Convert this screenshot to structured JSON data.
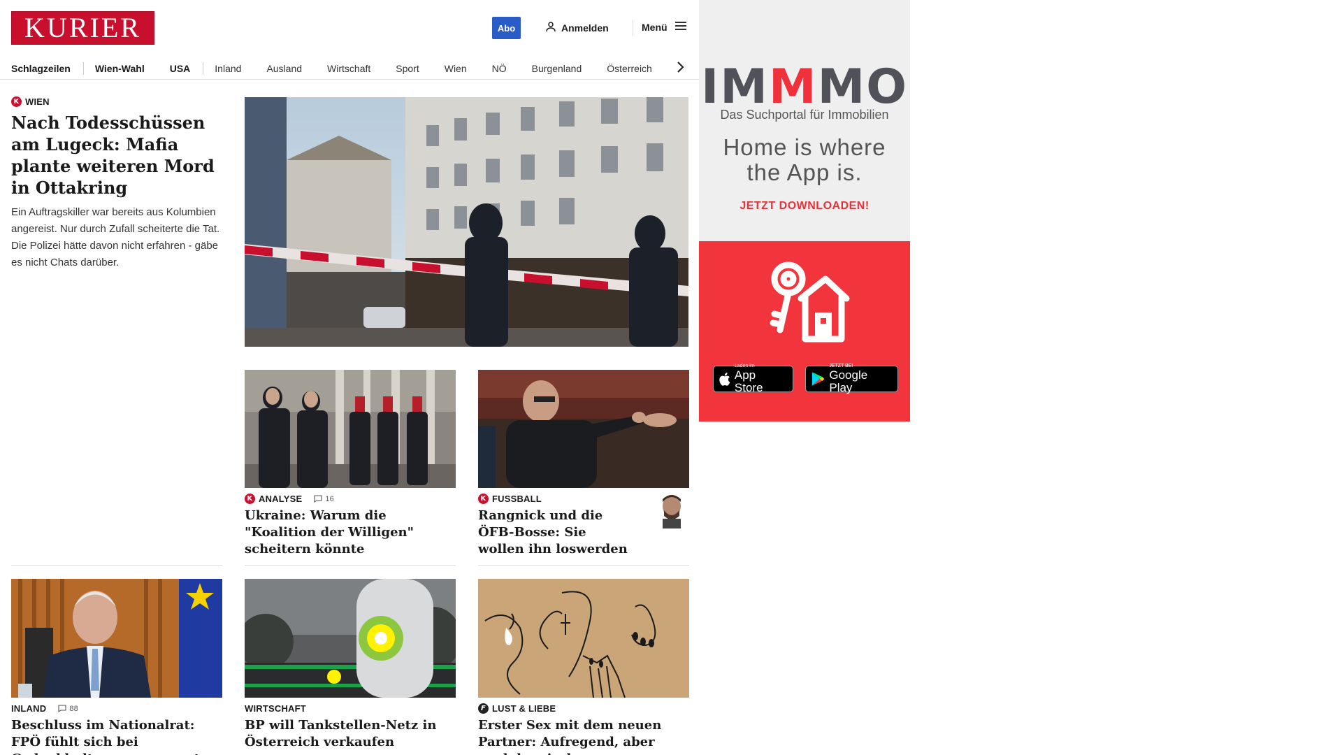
{
  "header": {
    "logo_text": "KURIER",
    "abo_label": "Abo",
    "login_label": "Anmelden",
    "menu_label": "Menü"
  },
  "nav": {
    "items": [
      "Schlagzeilen",
      "Wien-Wahl",
      "USA",
      "Inland",
      "Ausland",
      "Wirtschaft",
      "Sport",
      "Wien",
      "NÖ",
      "Burgenland",
      "Österreich"
    ]
  },
  "lead": {
    "category": "WIEN",
    "title": "Nach Todesschüssen am Lugeck: Mafia plante weiteren Mord in Ottakring",
    "teaser": "Ein Auftragskiller war bereits aus Kolumbien angereist. Nur durch Zufall scheiterte die Tat. Die Polizei hätte davon nicht erfahren - gäbe es nicht Chats darüber."
  },
  "articles": [
    {
      "category": "ANALYSE",
      "comments": "16",
      "title": "Ukraine: Warum die \"Koalition der Willigen\" scheitern könnte"
    },
    {
      "category": "FUSSBALL",
      "title": "Rangnick und die ÖFB-Bosse: Sie wollen ihn loswerden"
    },
    {
      "category": "INLAND",
      "comments": "88",
      "title": "Beschluss im Nationalrat: FPÖ fühlt sich bei Gedenkkultur ausgegrenzt"
    },
    {
      "category": "WIRTSCHAFT",
      "title": "BP will Tankstellen-Netz in Österreich verkaufen"
    },
    {
      "category": "LUST & LIEBE",
      "title": "Erster Sex mit dem neuen Partner: Aufregend, aber auch komisch"
    }
  ],
  "ad": {
    "brand_left": "IM",
    "brand_mid": "M",
    "brand_right": "MO",
    "subtitle": "Das Suchportal für Immobilien",
    "slogan": "Home is where the App is.",
    "cta": "JETZT DOWNLOADEN!",
    "appstore_small": "Laden im",
    "appstore_large": "App Store",
    "googleplay_small": "JETZT BEI",
    "googleplay_large": "Google Play"
  },
  "colors": {
    "brand_red": "#c8102e",
    "abo_blue": "#2a5cc7",
    "ad_red": "#f2353c",
    "ad_grey": "#efefef"
  }
}
